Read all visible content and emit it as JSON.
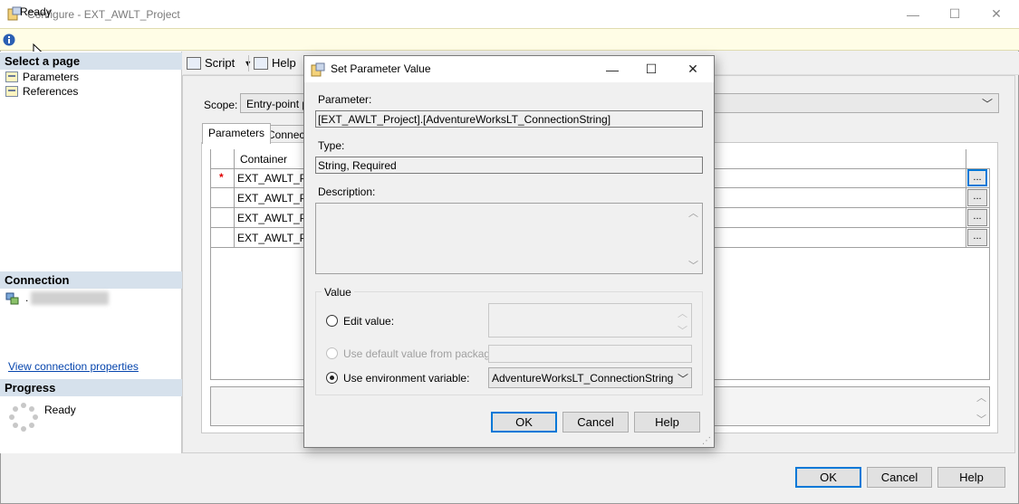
{
  "window": {
    "title": "Configure - EXT_AWLT_Project",
    "minimize": "—",
    "maximize": "☐",
    "close": "✕"
  },
  "status": {
    "text": "Ready"
  },
  "left": {
    "select_page": "Select a page",
    "pages": [
      "Parameters",
      "References"
    ],
    "connection_header": "Connection",
    "connection_server": ".",
    "view_connection": "View connection properties",
    "progress_header": "Progress",
    "progress_status": "Ready"
  },
  "toolbar": {
    "script": "Script",
    "help": "Help"
  },
  "main": {
    "scope_label": "Scope:",
    "scope_value": "Entry-point pa",
    "tabs": [
      "Parameters",
      "Connecti"
    ],
    "grid_header": "Container",
    "rows": [
      {
        "marker": "*",
        "container": "EXT_AWLT_P..."
      },
      {
        "marker": "",
        "container": "EXT_AWLT_P..."
      },
      {
        "marker": "",
        "container": "EXT_AWLT_P..."
      },
      {
        "marker": "",
        "container": "EXT_AWLT_P..."
      }
    ],
    "ellipsis": "...",
    "ok": "OK",
    "cancel": "Cancel",
    "help": "Help"
  },
  "dialog": {
    "title": "Set Parameter Value",
    "parameter_label": "Parameter:",
    "parameter_value": "[EXT_AWLT_Project].[AdventureWorksLT_ConnectionString]",
    "type_label": "Type:",
    "type_value": "String, Required",
    "description_label": "Description:",
    "value_group": "Value",
    "edit_value": "Edit value:",
    "use_default": "Use default value from package",
    "use_env": "Use environment variable:",
    "env_value": "AdventureWorksLT_ConnectionString",
    "ok": "OK",
    "cancel": "Cancel",
    "help": "Help"
  },
  "colors": {
    "accent": "#0078d7",
    "status_bar": "#fffde6",
    "section_header": "#d6e1ec",
    "link": "#0645ad",
    "required_marker": "#e00000"
  }
}
